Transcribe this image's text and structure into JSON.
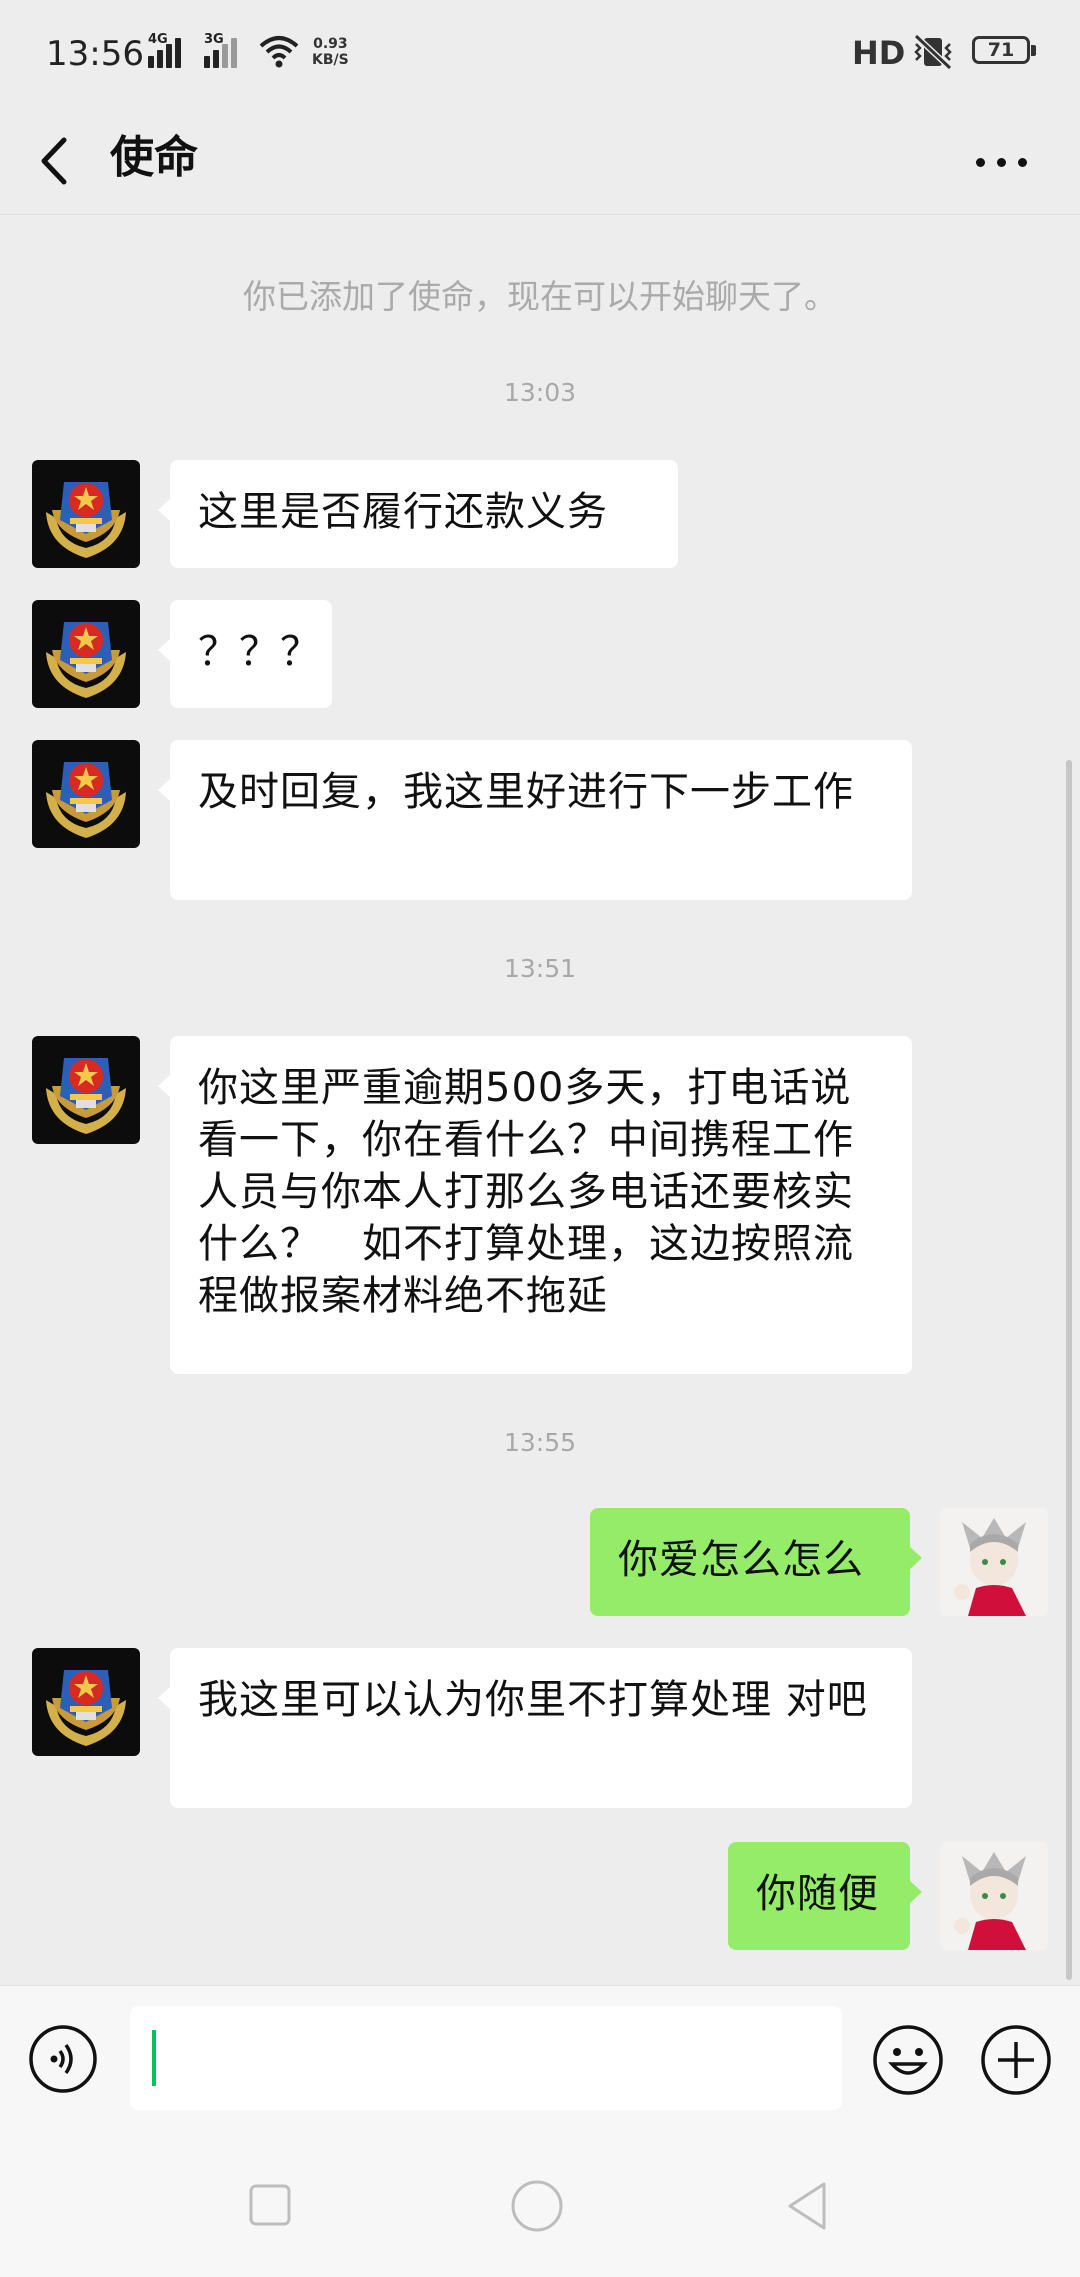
{
  "status_bar": {
    "time": "13:56",
    "network1": "4G",
    "network2": "3G",
    "speed_value": "0.93",
    "speed_unit": "KB/S",
    "hd": "HD",
    "battery": "71"
  },
  "header": {
    "title": "使命",
    "back_icon": "chevron-left-icon",
    "more_icon": "more-dots-icon"
  },
  "chat": {
    "system_message": "你已添加了使命，现在可以开始聊天了。",
    "timestamps": [
      "13:03",
      "13:51",
      "13:55"
    ],
    "messages": [
      {
        "side": "left",
        "text": "这里是否履行还款义务"
      },
      {
        "side": "left",
        "text": "？？？"
      },
      {
        "side": "left",
        "text": "及时回复，我这里好进行下一步工作"
      },
      {
        "side": "left",
        "text": "你这里严重逾期500多天，打电话说看一下，你在看什么？中间携程工作人员与你本人打那么多电话还要核实什么？　如不打算处理，这边按照流程做报案材料绝不拖延"
      },
      {
        "side": "right",
        "text": "你爱怎么怎么"
      },
      {
        "side": "left",
        "text": "我这里可以认为你里不打算处理 对吧"
      },
      {
        "side": "right",
        "text": "你随便"
      }
    ]
  },
  "input_bar": {
    "voice_icon": "voice-icon",
    "emoji_icon": "emoji-icon",
    "plus_icon": "plus-icon",
    "value": ""
  },
  "nav_bar": {
    "recents_icon": "square-icon",
    "home_icon": "circle-icon",
    "back_icon": "triangle-back-icon"
  },
  "colors": {
    "background": "#ededed",
    "bubble_left": "#ffffff",
    "bubble_right": "#95ec69",
    "cursor": "#07c160"
  }
}
